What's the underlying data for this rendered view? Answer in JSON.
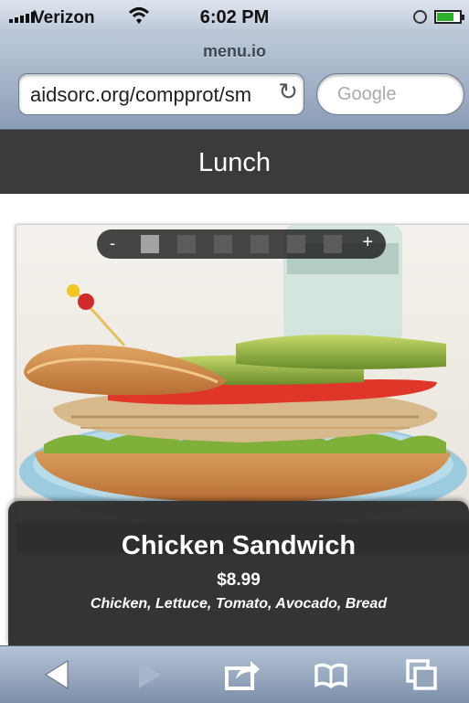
{
  "status": {
    "carrier": "Verizon",
    "time": "6:02 PM"
  },
  "browser": {
    "page_title": "menu.io",
    "url": "aidsorc.org/compprot/sm",
    "search_placeholder": "Google"
  },
  "header": {
    "title": "Lunch"
  },
  "pager": {
    "minus": "-",
    "plus": "+",
    "pages": 6,
    "active": 0
  },
  "item": {
    "name": "Chicken Sandwich",
    "price": "$8.99",
    "description": "Chicken, Lettuce, Tomato, Avocado, Bread"
  },
  "toolbar": {
    "icons": [
      "back-arrow-icon",
      "forward-arrow-icon",
      "share-icon",
      "bookmarks-icon",
      "tabs-icon"
    ]
  }
}
